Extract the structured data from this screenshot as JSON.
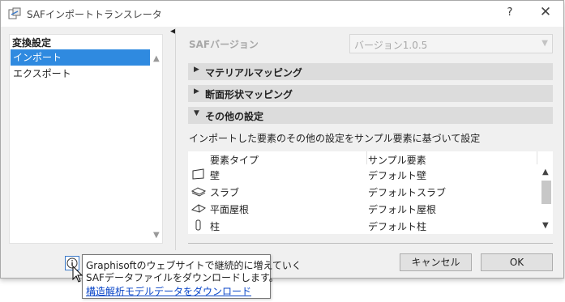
{
  "window": {
    "title": "SAFインポートトランスレータ",
    "help_button": "?",
    "close_button": "✕"
  },
  "left_panel": {
    "heading": "変換設定",
    "items": [
      {
        "label": "インポート",
        "selected": true
      },
      {
        "label": "エクスポート",
        "selected": false
      }
    ]
  },
  "version": {
    "label": "SAFバージョン",
    "value": "バージョン1.0.5"
  },
  "sections": [
    {
      "label": "マテリアルマッピング",
      "expanded": false
    },
    {
      "label": "断面形状マッピング",
      "expanded": false
    },
    {
      "label": "その他の設定",
      "expanded": true
    }
  ],
  "description": "インポートした要素のその他の設定をサンプル要素に基づいて設定",
  "table": {
    "headers": [
      "要素タイプ",
      "サンプル要素"
    ],
    "rows": [
      {
        "type": "壁",
        "sample": "デフォルト壁",
        "icon": "wall-icon"
      },
      {
        "type": "スラブ",
        "sample": "デフォルトスラブ",
        "icon": "slab-icon"
      },
      {
        "type": "平面屋根",
        "sample": "デフォルト屋根",
        "icon": "roof-icon"
      },
      {
        "type": "柱",
        "sample": "デフォルト柱",
        "icon": "column-icon"
      }
    ]
  },
  "buttons": {
    "cancel": "キャンセル",
    "ok": "OK"
  },
  "tooltip": {
    "line1": "Graphisoftのウェブサイトで継続的に増えていく",
    "line2": "SAFデータファイルをダウンロードします。",
    "link": "構造解析モデルデータをダウンロード"
  },
  "colors": {
    "selection": "#2f8ae0",
    "section_bar": "#dcdcdc",
    "link": "#0a46c8"
  }
}
